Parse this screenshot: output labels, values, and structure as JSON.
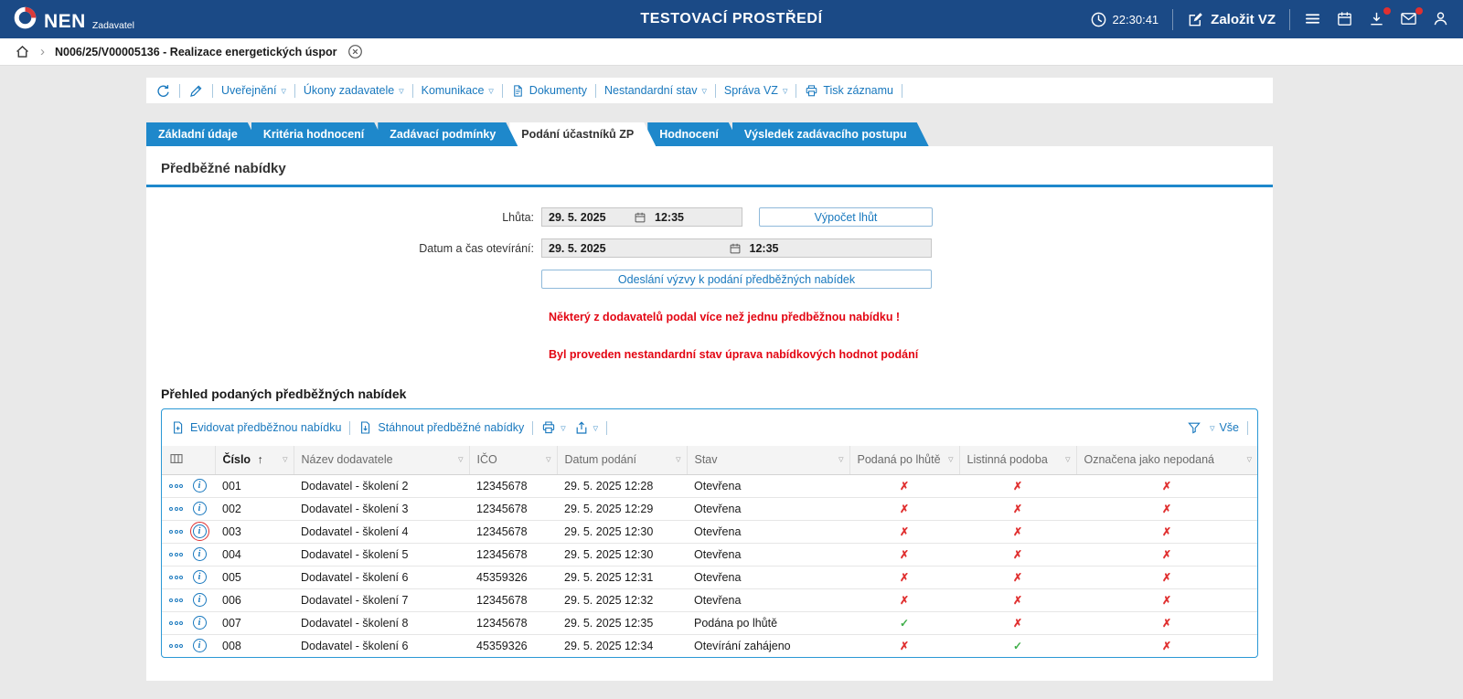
{
  "topbar": {
    "brand": "NEN",
    "brand_sub": "Zadavatel",
    "title": "TESTOVACÍ PROSTŘEDÍ",
    "clock": "22:30:41",
    "create_vz_label": "Založit VZ"
  },
  "breadcrumb": {
    "item": "N006/25/V00005136 - Realizace energetických úspor"
  },
  "record_toolbar": {
    "items": [
      {
        "label": "Uveřejnění"
      },
      {
        "label": "Úkony zadavatele"
      },
      {
        "label": "Komunikace"
      },
      {
        "label": "Dokumenty"
      },
      {
        "label": "Nestandardní stav"
      },
      {
        "label": "Správa VZ"
      },
      {
        "label": "Tisk záznamu"
      }
    ]
  },
  "tabs": [
    {
      "label": "Základní údaje",
      "active": false
    },
    {
      "label": "Kritéria hodnocení",
      "active": false
    },
    {
      "label": "Zadávací podmínky",
      "active": false
    },
    {
      "label": "Podání účastníků ZP",
      "active": true
    },
    {
      "label": "Hodnocení",
      "active": false
    },
    {
      "label": "Výsledek zadávacího postupu",
      "active": false
    }
  ],
  "section": {
    "title": "Předběžné nabídky"
  },
  "form": {
    "deadline_label": "Lhůta:",
    "deadline_date": "29. 5. 2025",
    "deadline_time": "12:35",
    "calc_button": "Výpočet lhůt",
    "opening_label": "Datum a čas otevírání:",
    "opening_date": "29. 5. 2025",
    "opening_time": "12:35",
    "send_button": "Odeslání výzvy k podání předběžných nabídek"
  },
  "warnings": [
    "Některý z dodavatelů podal více než jednu předběžnou nabídku !",
    "Byl proveden nestandardní stav úprava nabídkových hodnot podání"
  ],
  "table": {
    "title": "Přehled podaných předběžných nabídek",
    "toolbar": {
      "add_label": "Evidovat předběžnou nabídku",
      "download_label": "Stáhnout předběžné nabídky",
      "filter_all_label": "Vše"
    },
    "columns": [
      "Číslo",
      "Název dodavatele",
      "IČO",
      "Datum podání",
      "Stav",
      "Podaná po lhůtě",
      "Listinná podoba",
      "Označena jako nepodaná"
    ],
    "rows": [
      {
        "cislo": "001",
        "nazev": "Dodavatel - školení 2",
        "ico": "12345678",
        "datum": "29. 5. 2025 12:28",
        "stav": "Otevřena",
        "po_lhute": false,
        "listinna": false,
        "nepodana": false,
        "focused": false
      },
      {
        "cislo": "002",
        "nazev": "Dodavatel - školení 3",
        "ico": "12345678",
        "datum": "29. 5. 2025 12:29",
        "stav": "Otevřena",
        "po_lhute": false,
        "listinna": false,
        "nepodana": false,
        "focused": false
      },
      {
        "cislo": "003",
        "nazev": "Dodavatel - školení 4",
        "ico": "12345678",
        "datum": "29. 5. 2025 12:30",
        "stav": "Otevřena",
        "po_lhute": false,
        "listinna": false,
        "nepodana": false,
        "focused": true
      },
      {
        "cislo": "004",
        "nazev": "Dodavatel - školení 5",
        "ico": "12345678",
        "datum": "29. 5. 2025 12:30",
        "stav": "Otevřena",
        "po_lhute": false,
        "listinna": false,
        "nepodana": false,
        "focused": false
      },
      {
        "cislo": "005",
        "nazev": "Dodavatel - školení 6",
        "ico": "45359326",
        "datum": "29. 5. 2025 12:31",
        "stav": "Otevřena",
        "po_lhute": false,
        "listinna": false,
        "nepodana": false,
        "focused": false
      },
      {
        "cislo": "006",
        "nazev": "Dodavatel - školení 7",
        "ico": "12345678",
        "datum": "29. 5. 2025 12:32",
        "stav": "Otevřena",
        "po_lhute": false,
        "listinna": false,
        "nepodana": false,
        "focused": false
      },
      {
        "cislo": "007",
        "nazev": "Dodavatel - školení 8",
        "ico": "12345678",
        "datum": "29. 5. 2025 12:35",
        "stav": "Podána po lhůtě",
        "po_lhute": true,
        "listinna": false,
        "nepodana": false,
        "focused": false
      },
      {
        "cislo": "008",
        "nazev": "Dodavatel - školení 6",
        "ico": "45359326",
        "datum": "29. 5. 2025 12:34",
        "stav": "Otevírání zahájeno",
        "po_lhute": false,
        "listinna": true,
        "nepodana": false,
        "focused": false
      }
    ]
  },
  "icons": {
    "dropdown": "▽",
    "sort_asc": "↑",
    "check": "✓",
    "cross": "✗",
    "chevron": "›",
    "info": "i"
  },
  "colors": {
    "topbar": "#1b4a86",
    "accent_blue": "#1e88cb",
    "link_blue": "#1878be",
    "warning_red": "#e30613",
    "ok_green": "#3fae49",
    "cross_red": "#e03030"
  }
}
